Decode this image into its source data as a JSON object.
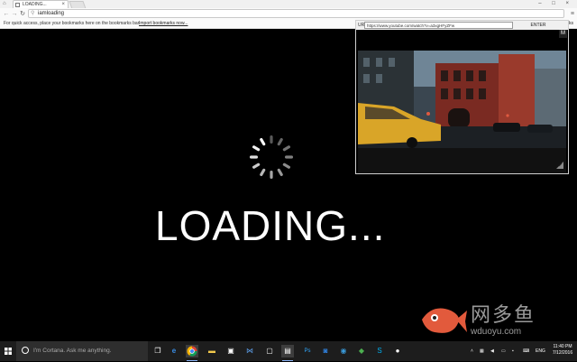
{
  "browser": {
    "tab_title": "LOADING...",
    "tab_close": "×",
    "address": "iamloading",
    "window_controls": "– □ ×",
    "menu_icon": "≡"
  },
  "bookmarks_bar": {
    "message": "For quick access, place your bookmarks here on the bookmarks bar.",
    "import_link": "Import bookmarks now...",
    "other": "arks"
  },
  "page": {
    "loading_text": "LOADING..."
  },
  "popup": {
    "url_label": "URL",
    "url_value": "https://www.youtube.com/watch?v=a3xgHFyZFw",
    "enter_label": "ENTER",
    "logo_glyph": "M"
  },
  "watermark": {
    "brand": "网多鱼",
    "domain": "wduoyu.com"
  },
  "taskbar": {
    "search_placeholder": "I'm Cortana. Ask me anything.",
    "language": "ENG",
    "time": "11:40 PM",
    "date": "7/12/2016"
  },
  "colors": {
    "page_bg": "#000000",
    "loading_text": "#ffffff",
    "taskbar_bg": "#1d1d1d",
    "fish_accent": "#e25a3c",
    "taxi_yellow": "#d9a528",
    "brick_red": "#7a2a22"
  }
}
